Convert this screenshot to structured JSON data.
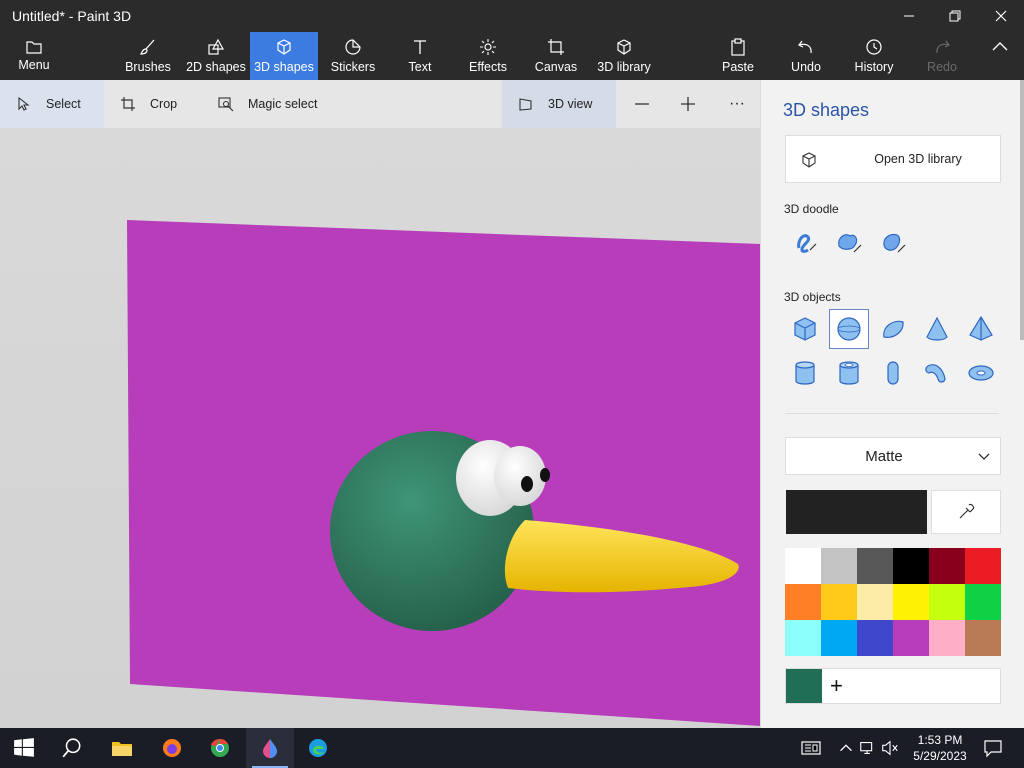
{
  "window": {
    "title": "Untitled* - Paint 3D"
  },
  "ribbon": {
    "menu": "Menu",
    "brushes": "Brushes",
    "shapes2d": "2D shapes",
    "shapes3d": "3D shapes",
    "stickers": "Stickers",
    "text": "Text",
    "effects": "Effects",
    "canvas": "Canvas",
    "library3d": "3D library",
    "paste": "Paste",
    "undo": "Undo",
    "history": "History",
    "redo": "Redo"
  },
  "toolbar": {
    "select": "Select",
    "crop": "Crop",
    "magic_select": "Magic select",
    "view3d": "3D view",
    "more": "···"
  },
  "panel": {
    "title": "3D shapes",
    "open_library": "Open 3D library",
    "doodle_heading": "3D doodle",
    "objects_heading": "3D objects",
    "material": "Matte",
    "current_color": "#222222",
    "custom_color": "#1f6e55",
    "palette": [
      "#ffffff",
      "#c3c3c3",
      "#585858",
      "#000000",
      "#88001b",
      "#ec1c24",
      "#ff7f27",
      "#ffca18",
      "#fdeca6",
      "#fff200",
      "#c4ff0e",
      "#0ed145",
      "#8cfffb",
      "#00a8f3",
      "#3f48cc",
      "#b83dba",
      "#ffaec8",
      "#b97a56"
    ]
  },
  "scene": {
    "plane_color": "#b83dba",
    "body_color": "#2e7a5e",
    "beak_color": "#ffd21e"
  },
  "taskbar": {
    "time": "1:53 PM",
    "date": "5/29/2023"
  }
}
